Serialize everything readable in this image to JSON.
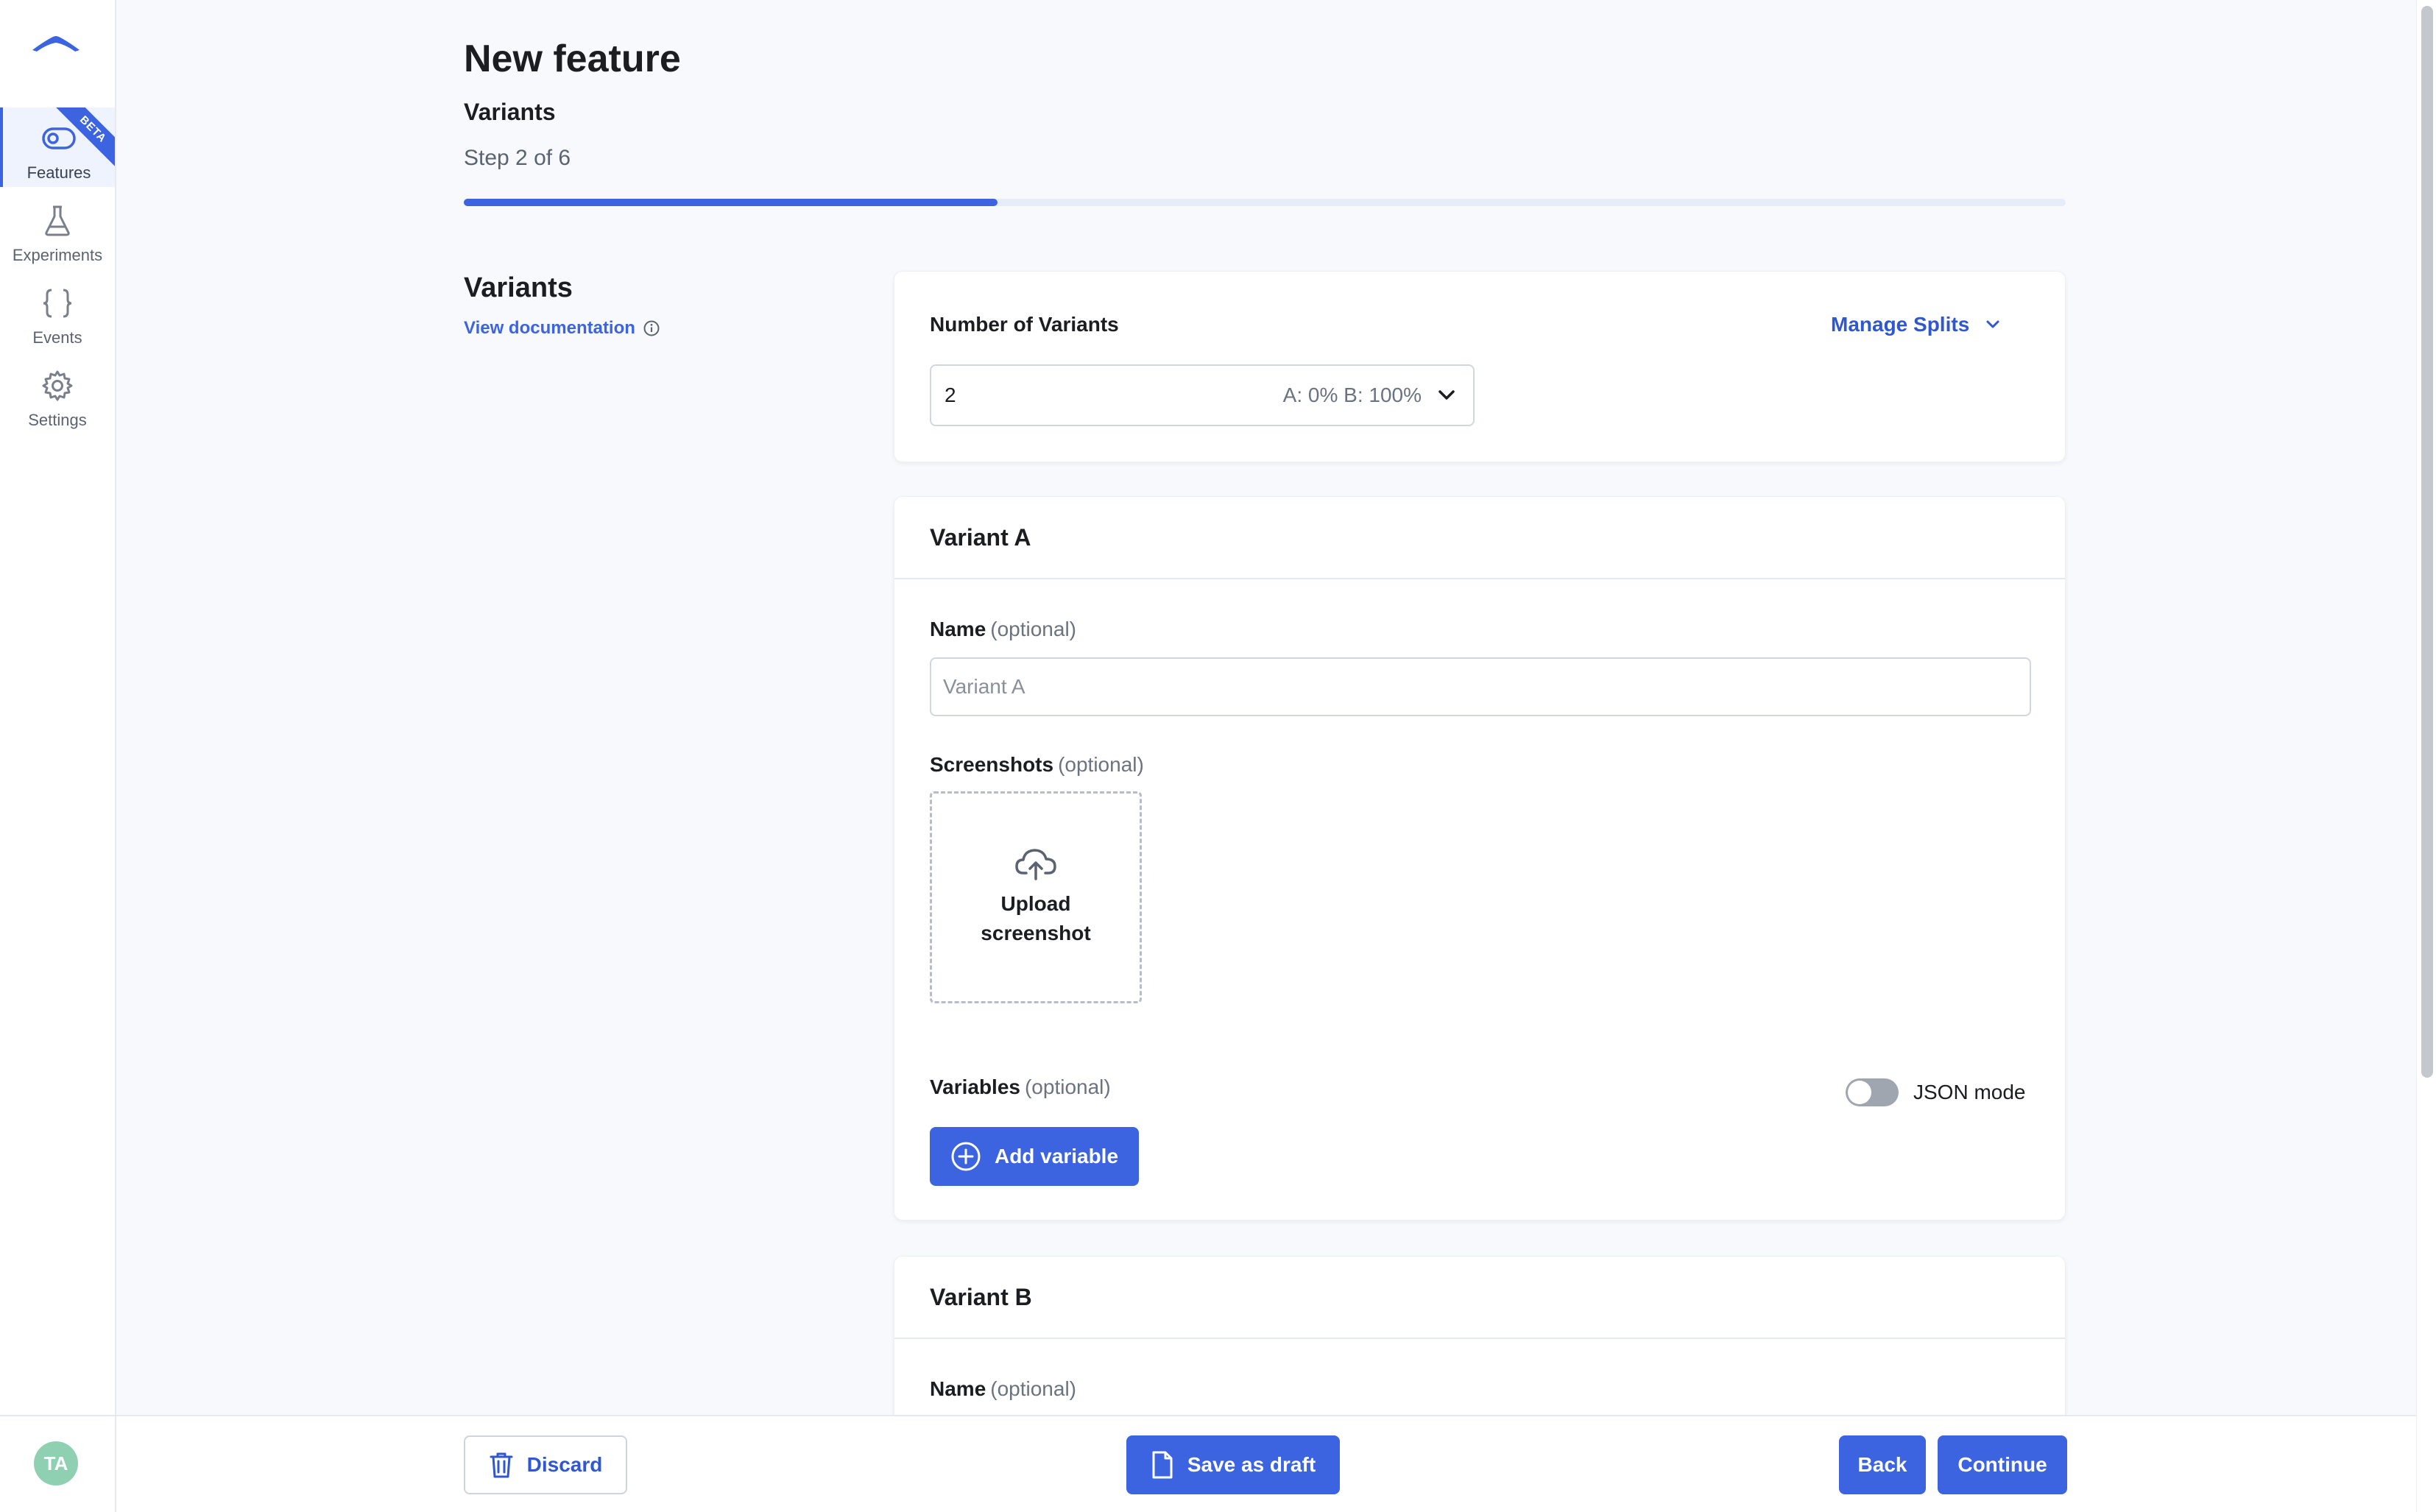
{
  "sidebar": {
    "items": [
      {
        "label": "Features",
        "icon": "toggle-icon",
        "active": true
      },
      {
        "label": "Experiments",
        "icon": "flask-icon"
      },
      {
        "label": "Events",
        "icon": "braces-icon"
      },
      {
        "label": "Settings",
        "icon": "gear-icon"
      }
    ],
    "beta_badge": "BETA",
    "avatar_initials": "TA"
  },
  "header": {
    "title": "New feature",
    "subtitle": "Variants",
    "step": "Step 2 of 6",
    "progress": 0.333
  },
  "section": {
    "title": "Variants",
    "doc_link": "View documentation"
  },
  "variants_card": {
    "number_label": "Number of Variants",
    "manage_splits": "Manage Splits",
    "selected_value": "2",
    "split_summary": "A: 0% B: 100%"
  },
  "variant_a": {
    "title": "Variant A",
    "name_label": "Name",
    "optional": "(optional)",
    "name_placeholder": "Variant A",
    "screenshots_label": "Screenshots",
    "upload_text": "Upload screenshot",
    "variables_label": "Variables",
    "json_mode_label": "JSON mode",
    "json_mode_on": false,
    "add_variable": "Add variable"
  },
  "variant_b": {
    "title": "Variant B",
    "name_label": "Name",
    "optional": "(optional)"
  },
  "footer": {
    "discard": "Discard",
    "save_draft": "Save as draft",
    "back": "Back",
    "continue": "Continue"
  },
  "colors": {
    "accent": "#3d64e0",
    "background": "#f7f9fc",
    "avatar": "#8fd0b3"
  }
}
